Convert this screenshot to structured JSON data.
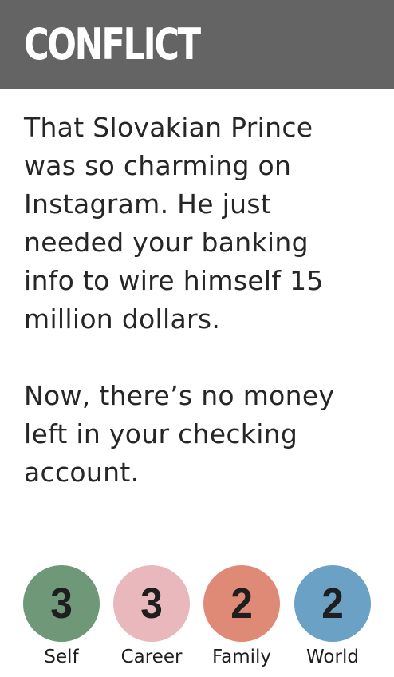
{
  "header": {
    "title": "CONFLICT"
  },
  "body": {
    "paragraph_1": "That Slovakian Prince\nwas so charming on\nInstagram. He just\nneeded your banking\ninfo to wire himself 15\nmillion dollars.",
    "paragraph_2": "Now, there’s no money\nleft in your checking\naccount."
  },
  "stats": [
    {
      "label": "Self",
      "value": "3",
      "color": "#6e9878"
    },
    {
      "label": "Career",
      "value": "3",
      "color": "#e8b8bc"
    },
    {
      "label": "Family",
      "value": "2",
      "color": "#de8a76"
    },
    {
      "label": "World",
      "value": "2",
      "color": "#6aa1c4"
    }
  ],
  "colors": {
    "header_background": "#646464",
    "header_text": "#ffffff",
    "body_text": "#262626"
  }
}
